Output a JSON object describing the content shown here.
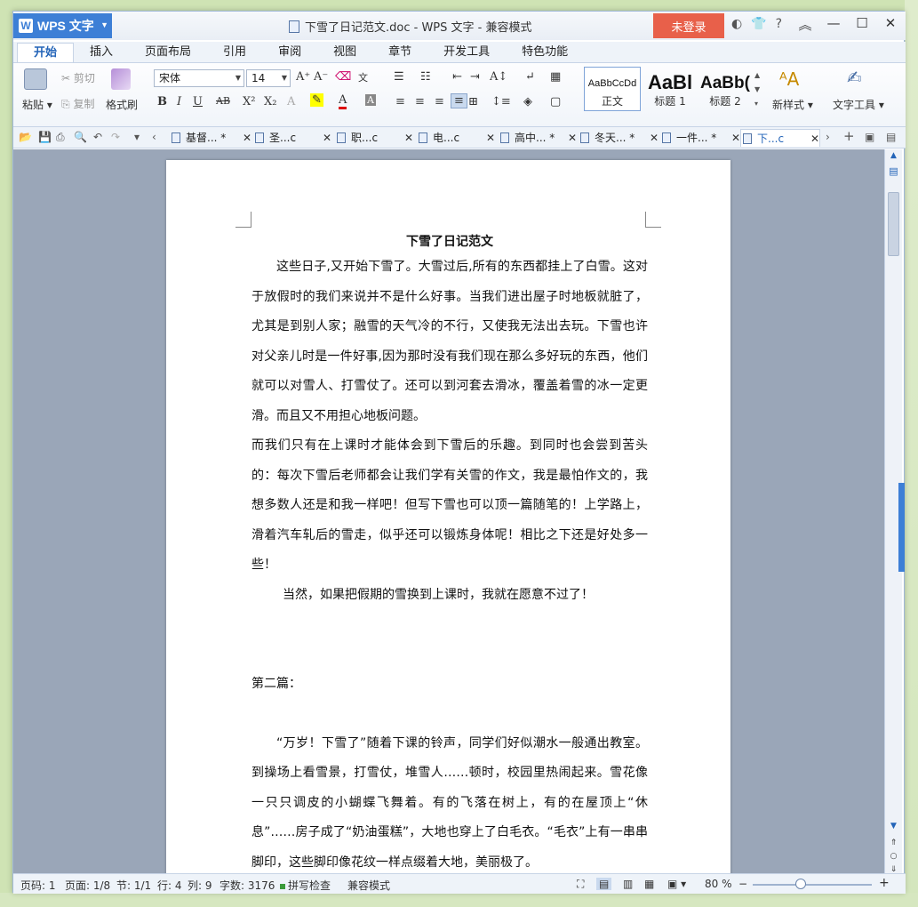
{
  "titlebar": {
    "app_name": "WPS 文字",
    "document_title": "下雪了日记范文.doc - WPS 文字 - 兼容模式",
    "login": "未登录"
  },
  "ribbon_tabs": [
    "开始",
    "插入",
    "页面布局",
    "引用",
    "审阅",
    "视图",
    "章节",
    "开发工具",
    "特色功能"
  ],
  "ribbon": {
    "paste": "粘贴",
    "cut": "剪切",
    "copy": "复制",
    "format_painter": "格式刷",
    "font_name": "宋体",
    "font_size": "14",
    "styles": [
      {
        "sample": "AaBbCcDd",
        "label": "正文"
      },
      {
        "sample": "AaBl",
        "label": "标题 1"
      },
      {
        "sample": "AaBb(",
        "label": "标题 2"
      }
    ],
    "new_style": "新样式",
    "text_tools": "文字工具"
  },
  "doc_tabs": [
    {
      "label": "基督...",
      "modified": "*"
    },
    {
      "label": "圣...c",
      "modified": ""
    },
    {
      "label": "职...c",
      "modified": ""
    },
    {
      "label": "电...c",
      "modified": ""
    },
    {
      "label": "高中...",
      "modified": "*"
    },
    {
      "label": "冬天...",
      "modified": "*"
    },
    {
      "label": "一件...",
      "modified": "*"
    },
    {
      "label": "下...c",
      "modified": ""
    }
  ],
  "document": {
    "title": "下雪了日记范文",
    "para1": "这些日子,又开始下雪了。大雪过后,所有的东西都挂上了白雪。这对于放假时的我们来说并不是什么好事。当我们进出屋子时地板就脏了，尤其是到别人家；融雪的天气冷的不行，又使我无法出去玩。下雪也许对父亲儿时是一件好事,因为那时没有我们现在那么多好玩的东西，他们就可以对雪人、打雪仗了。还可以到河套去滑冰，覆盖着雪的冰一定更滑。而且又不用担心地板问题。",
    "para2": "而我们只有在上课时才能体会到下雪后的乐趣。到同时也会尝到苦头的：每次下雪后老师都会让我们学有关雪的作文，我是最怕作文的，我想多数人还是和我一样吧！但写下雪也可以顶一篇随笔的！上学路上，滑着汽车轧后的雪走，似乎还可以锻炼身体呢！相比之下还是好处多一些！",
    "para3": "当然，如果把假期的雪换到上课时，我就在愿意不过了！",
    "section2": "第二篇：",
    "para4": "“万岁！下雪了”随着下课的铃声，同学们好似潮水一般通出教室。到操场上看雪景，打雪仗，堆雪人……顿时，校园里热闹起来。雪花像一只只调皮的小蝴蝶飞舞着。有的飞落在树上，有的在屋顶上“休息”……房子成了“奶油蛋糕”，大地也穿上了白毛衣。“毛衣”上有一串串脚印，这些脚印像花纹一样点缀着大地，美丽极了。"
  },
  "statusbar": {
    "page_code": "页码: 1",
    "pages": "页面: 1/8",
    "section": "节: 1/1",
    "row": "行: 4",
    "col": "列: 9",
    "word_count": "字数: 3176",
    "spell_check": "拼写检查",
    "compat": "兼容模式",
    "zoom": "80 %"
  }
}
